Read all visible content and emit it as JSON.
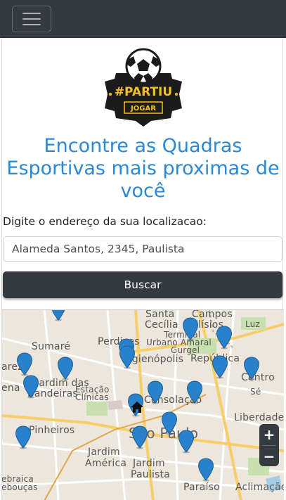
{
  "navbar": {
    "toggle_icon": "hamburger-menu-icon"
  },
  "logo": {
    "line1": "#PARTIU",
    "line2": "JOGAR",
    "icon": "soccer-ball-icon"
  },
  "headline": [
    "Encontre as Quadras",
    "Esportivas mais proximas de",
    "você"
  ],
  "form": {
    "label": "Digite o endereço da sua localizacao:",
    "address_value": "Alameda Santos, 2345, Paulista",
    "button_label": "Buscar"
  },
  "map": {
    "zoom_in": "+",
    "zoom_out": "−",
    "places": [
      "Santa",
      "Cecília",
      "Campos",
      "Elísios",
      "Luz",
      "Terminal",
      "Urbano Amaral",
      "Gurgel",
      "República",
      "Perdizes",
      "Sumaré",
      "Higienópolis",
      "arezo",
      "ena",
      "Jardim das",
      "Bandeiras",
      "Estação",
      "Clínicas",
      "Consolação",
      "Centro",
      "Sé",
      "Liberdade",
      "São Paulo",
      "Pinheiros",
      "Jardim",
      "América",
      "Jardim",
      "Paulista",
      "Paraíso",
      "Aclimação",
      "ebraica",
      "ebouças"
    ],
    "colors": {
      "marker": "#2a81cb",
      "water": "#a5cde6",
      "park": "#c8dfae",
      "road": "#ffffff",
      "major_road": "#f6cf6a"
    }
  }
}
